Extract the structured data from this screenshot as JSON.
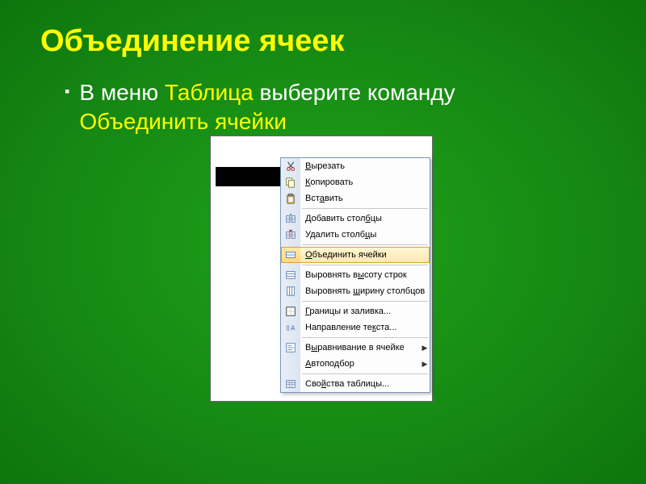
{
  "title": "Объединение ячеек",
  "bullet": {
    "prefix": "В меню ",
    "hl1": "Таблица",
    "mid": " выберите команду ",
    "hl2": "Объединить ячейки"
  },
  "menu": {
    "items": [
      {
        "label_pre": "",
        "mn": "В",
        "label_post": "ырезать",
        "icon": "cut",
        "arrow": false,
        "selected": false
      },
      {
        "label_pre": "",
        "mn": "К",
        "label_post": "опировать",
        "icon": "copy",
        "arrow": false,
        "selected": false
      },
      {
        "label_pre": "Вст",
        "mn": "а",
        "label_post": "вить",
        "icon": "paste",
        "arrow": false,
        "selected": false
      },
      {
        "sep": true
      },
      {
        "label_pre": "Добавить стол",
        "mn": "б",
        "label_post": "цы",
        "icon": "add-col",
        "arrow": false,
        "selected": false
      },
      {
        "label_pre": "Удалить столб",
        "mn": "ц",
        "label_post": "ы",
        "icon": "del-col",
        "arrow": false,
        "selected": false
      },
      {
        "sep": true
      },
      {
        "label_pre": "",
        "mn": "О",
        "label_post": "бъединить ячейки",
        "icon": "merge",
        "arrow": false,
        "selected": true
      },
      {
        "sep": true
      },
      {
        "label_pre": "Выровнять в",
        "mn": "ы",
        "label_post": "соту строк",
        "icon": "dist-row",
        "arrow": false,
        "selected": false
      },
      {
        "label_pre": "Выровнять ",
        "mn": "ш",
        "label_post": "ирину столбцов",
        "icon": "dist-col",
        "arrow": false,
        "selected": false
      },
      {
        "sep": true
      },
      {
        "label_pre": "",
        "mn": "Г",
        "label_post": "раницы и заливка...",
        "icon": "border",
        "arrow": false,
        "selected": false
      },
      {
        "label_pre": "Направление те",
        "mn": "к",
        "label_post": "ста...",
        "icon": "text-dir",
        "arrow": false,
        "selected": false
      },
      {
        "sep": true
      },
      {
        "label_pre": "В",
        "mn": "ы",
        "label_post": "равнивание в ячейке",
        "icon": "align",
        "arrow": true,
        "selected": false
      },
      {
        "label_pre": "",
        "mn": "А",
        "label_post": "втоподбор",
        "icon": "",
        "arrow": true,
        "selected": false
      },
      {
        "sep": true
      },
      {
        "label_pre": "Сво",
        "mn": "й",
        "label_post": "ства таблицы...",
        "icon": "props",
        "arrow": false,
        "selected": false
      }
    ]
  }
}
